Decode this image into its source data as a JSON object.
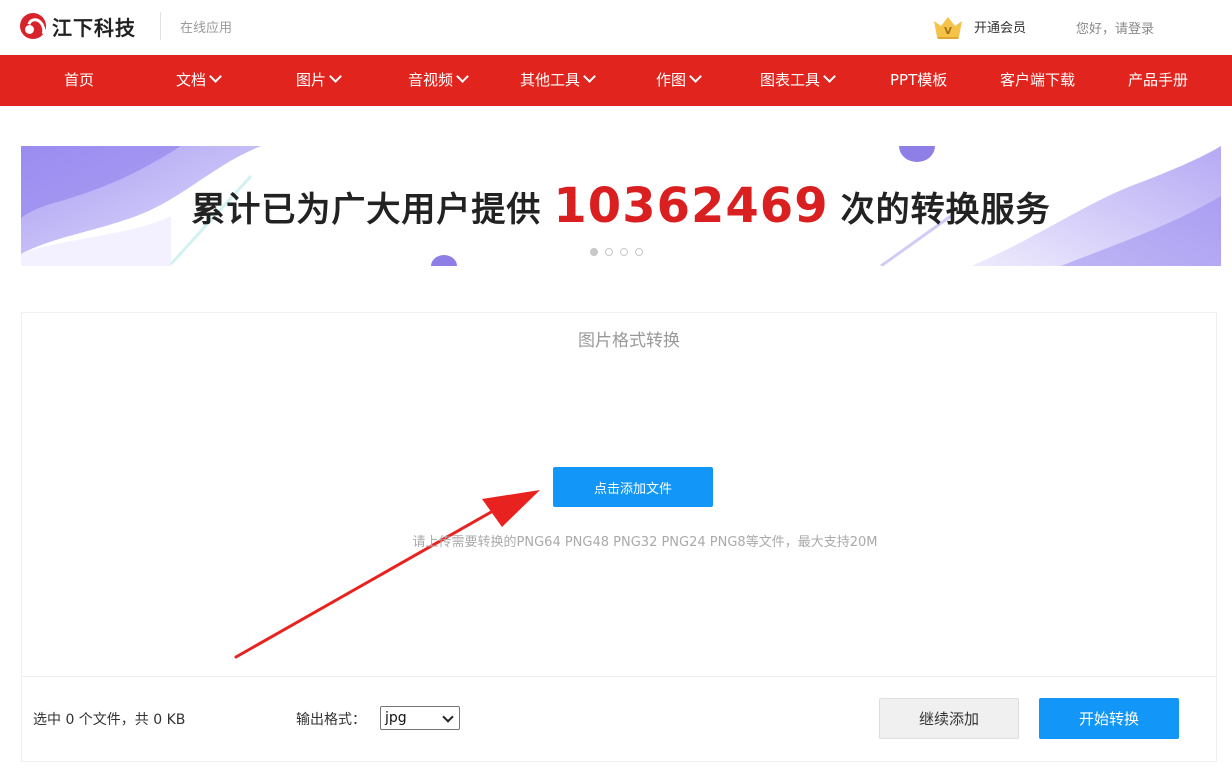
{
  "header": {
    "brand": "江下科技",
    "subtitle": "在线应用",
    "vip_label": "开通会员",
    "login_label": "您好，请登录"
  },
  "nav": {
    "items": [
      {
        "label": "首页",
        "dropdown": false
      },
      {
        "label": "文档",
        "dropdown": true
      },
      {
        "label": "图片",
        "dropdown": true
      },
      {
        "label": "音视频",
        "dropdown": true
      },
      {
        "label": "其他工具",
        "dropdown": true
      },
      {
        "label": "作图",
        "dropdown": true
      },
      {
        "label": "图表工具",
        "dropdown": true
      },
      {
        "label": "PPT模板",
        "dropdown": false
      },
      {
        "label": "客户端下载",
        "dropdown": false
      },
      {
        "label": "产品手册",
        "dropdown": false
      }
    ]
  },
  "banner": {
    "text_before": "累计已为广大用户提供",
    "count": "10362469",
    "text_after": "次的转换服务",
    "slide_count": 4,
    "active_slide": 1
  },
  "converter": {
    "title": "图片格式转换",
    "add_button": "点击添加文件",
    "hint": "请上传需要转换的PNG64 PNG48 PNG32 PNG24 PNG8等文件，最大支持20M",
    "status": "选中 0 个文件，共 0 KB",
    "format_label": "输出格式：",
    "format_value": "jpg",
    "continue_button": "继续添加",
    "start_button": "开始转换"
  },
  "colors": {
    "nav_red": "#e1241d",
    "primary_blue": "#1296f8",
    "count_red": "#d91f1f",
    "arrow_red": "#e8231f"
  }
}
